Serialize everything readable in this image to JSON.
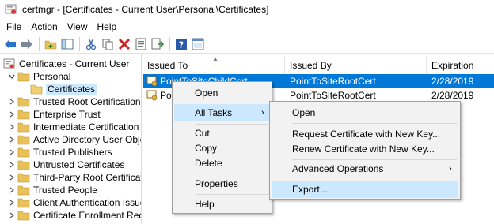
{
  "window": {
    "title": "certmgr - [Certificates - Current User\\Personal\\Certificates]",
    "icon": "certmgr-app-icon"
  },
  "menubar": {
    "items": [
      "File",
      "Action",
      "View",
      "Help"
    ]
  },
  "toolbar": {
    "icons": [
      "back-arrow-icon",
      "forward-arrow-icon",
      "up-folder-icon",
      "show-hide-tree-icon",
      "cut-icon",
      "copy-icon",
      "delete-icon",
      "properties-icon",
      "export-list-icon",
      "help-icon",
      "snapin-view-icon"
    ]
  },
  "tree": {
    "root": "Certificates - Current User",
    "items": [
      {
        "label": "Personal",
        "expanded": true
      },
      {
        "label": "Certificates",
        "selected": true
      },
      {
        "label": "Trusted Root Certification Au"
      },
      {
        "label": "Enterprise Trust"
      },
      {
        "label": "Intermediate Certification Au"
      },
      {
        "label": "Active Directory User Object"
      },
      {
        "label": "Trusted Publishers"
      },
      {
        "label": "Untrusted Certificates"
      },
      {
        "label": "Third-Party Root Certification"
      },
      {
        "label": "Trusted People"
      },
      {
        "label": "Client Authentication Issuers"
      },
      {
        "label": "Certificate Enrollment Reques"
      }
    ]
  },
  "list": {
    "columns": [
      "Issued To",
      "Issued By",
      "Expiration Date"
    ],
    "rows": [
      {
        "issued_to": "PointToSiteChildCert",
        "issued_by": "PointToSiteRootCert",
        "expiration": "2/28/2019",
        "selected": true
      },
      {
        "issued_to": "Poi",
        "issued_by": "PointToSiteRootCert",
        "expiration": "2/28/2019"
      }
    ]
  },
  "context_menu": {
    "items": [
      "Open",
      "All Tasks",
      "Cut",
      "Copy",
      "Delete",
      "Properties",
      "Help"
    ],
    "submenu_arrow": "›"
  },
  "submenu": {
    "items": [
      "Open",
      "Request Certificate with New Key...",
      "Renew Certificate with New Key...",
      "Advanced Operations",
      "Export..."
    ],
    "submenu_arrow": "›"
  },
  "colors": {
    "selection": "#0078d7",
    "hover": "#cce8ff",
    "folder": "#e8c15a",
    "menu_bg": "#f2f2f2"
  }
}
